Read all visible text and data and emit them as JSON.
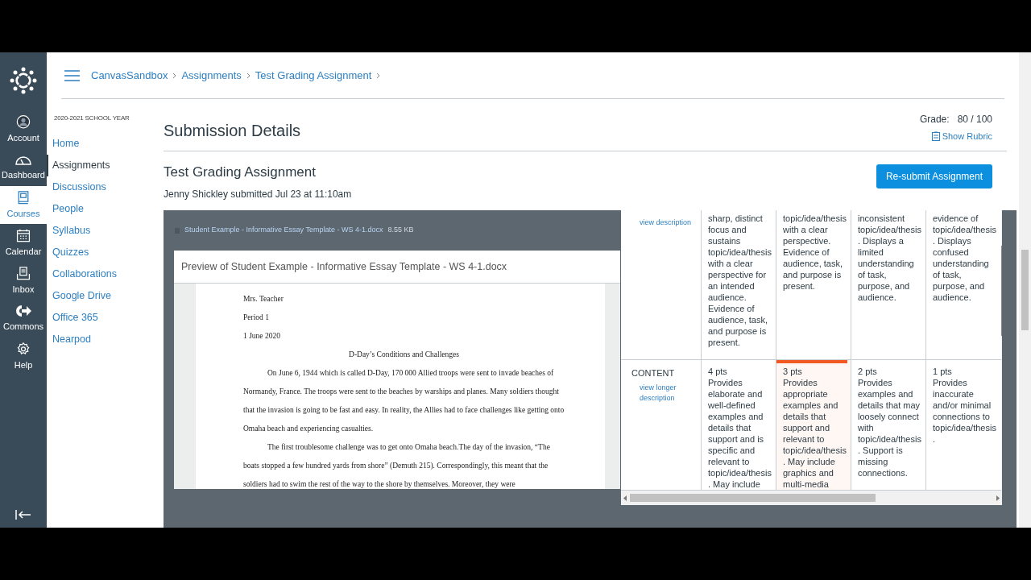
{
  "global_nav": [
    {
      "kind": "logo",
      "selected": false
    },
    {
      "kind": "account",
      "label": "Account",
      "selected": false
    },
    {
      "kind": "dashboard",
      "label": "Dashboard",
      "selected": false
    },
    {
      "kind": "courses",
      "label": "Courses",
      "selected": true
    },
    {
      "kind": "calendar",
      "label": "Calendar",
      "selected": false
    },
    {
      "kind": "inbox",
      "label": "Inbox",
      "selected": false
    },
    {
      "kind": "commons",
      "label": "Commons",
      "selected": false
    },
    {
      "kind": "help",
      "label": "Help",
      "selected": false
    }
  ],
  "breadcrumbs": [
    "CanvasSandbox",
    "Assignments",
    "Test Grading Assignment"
  ],
  "course_nav": {
    "term": "2020-2021 SCHOOL YEAR",
    "items": [
      {
        "label": "Home",
        "selected": false
      },
      {
        "label": "Assignments",
        "selected": true
      },
      {
        "label": "Discussions",
        "selected": false
      },
      {
        "label": "People",
        "selected": false
      },
      {
        "label": "Syllabus",
        "selected": false
      },
      {
        "label": "Quizzes",
        "selected": false
      },
      {
        "label": "Collaborations",
        "selected": false
      },
      {
        "label": "Google Drive",
        "selected": false
      },
      {
        "label": "Office 365",
        "selected": false
      },
      {
        "label": "Nearpod",
        "selected": false
      }
    ]
  },
  "page_title": "Submission Details",
  "grade": {
    "label": "Grade:",
    "value": "80 / 100"
  },
  "show_rubric": "Show Rubric",
  "assignment": {
    "title": "Test Grading Assignment",
    "submitted": "Jenny Shickley submitted Jul 23 at 11:10am"
  },
  "resubmit_button": "Re-submit Assignment",
  "attachment": {
    "file": "Student Example - Informative Essay Template - WS 4-1.docx",
    "size": "8.55 KB"
  },
  "preview": {
    "title": "Preview of Student Example - Informative Essay Template - WS 4-1.docx",
    "document": [
      {
        "kind": "line",
        "text": "Mrs. Teacher"
      },
      {
        "kind": "line",
        "text": "Period 1"
      },
      {
        "kind": "line",
        "text": "1 June 2020"
      },
      {
        "kind": "heading",
        "text": "D-Day’s Conditions and Challenges"
      },
      {
        "kind": "paragraph",
        "text": "On June 6, 1944 which is called D-Day, 170 000 Allied troops were sent to invade beaches of Normandy, France. The troops were sent to the beaches by warships and planes. Many soldiers thought that the invasion is going to be fast and easy. In reality,  the Allies had to face challenges like getting onto Omaha beach and experiencing casualties."
      },
      {
        "kind": "paragraph",
        "text": "The first troublesome challenge was to get onto Omaha beach.The day of the invasion, “The boats stopped a few hundred yards from shore” (Demuth 215). Correspondingly, this meant that the soldiers had to swim the rest of the way to the shore by themselves. Moreover, they were"
      }
    ]
  },
  "rubric": {
    "rows": [
      {
        "link": "view description",
        "ratings": [
          {
            "text": "sharp, distinct focus and sustains topic/idea/thesis with a clear perspective for an intended audience. Evidence of audience, task, and purpose is present.",
            "selected": false
          },
          {
            "text": "topic/idea/thesis with a clear perspective. Evidence of audience, task, and purpose is present.",
            "selected": false
          },
          {
            "text": "inconsistent topic/idea/thesis. Displays a limited understanding of task, purpose, and audience.",
            "selected": false
          },
          {
            "text": "evidence of topic/idea/thesis. Displays confused understanding of task, purpose, and audience.",
            "selected": false
          }
        ]
      },
      {
        "criterion": "CONTENT",
        "link": "view longer description",
        "ratings": [
          {
            "points": "4 pts",
            "text": "Provides elaborate and well-defined examples and details that support and is specific and relevant to topic/idea/thesis. May include",
            "selected": false
          },
          {
            "points": "3 pts",
            "text": "Provides appropriate examples and details that support and relevant to topic/idea/thesis. May include graphics and multi-media",
            "selected": true
          },
          {
            "points": "2 pts",
            "text": "Provides examples and details that may loosely connect with topic/idea/thesis. Support is missing connections.",
            "selected": false
          },
          {
            "points": "1 pts",
            "text": "Provides inaccurate and/or minimal connections to topic/idea/thesis.",
            "selected": false
          }
        ]
      }
    ]
  }
}
